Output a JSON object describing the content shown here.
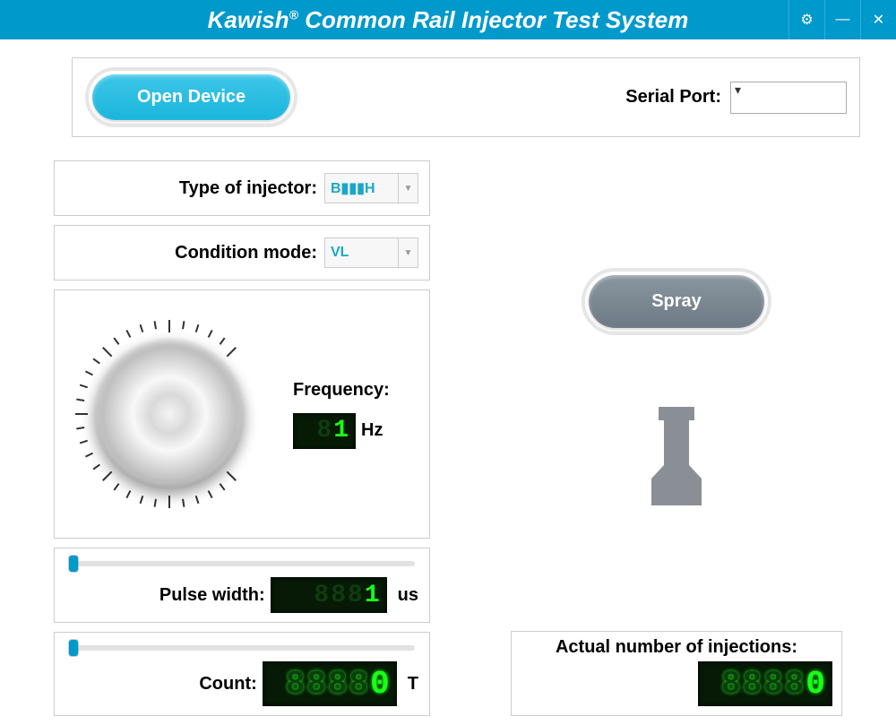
{
  "title_html": "Kawish® Common Rail Injector Test System",
  "window": {
    "settings": "⚙",
    "minimize": "—",
    "close": "✕"
  },
  "open_device_label": "Open Device",
  "serial_port": {
    "label": "Serial Port:",
    "value": ""
  },
  "injector_type": {
    "label": "Type of injector:",
    "value": "B▮▮▮H"
  },
  "condition_mode": {
    "label": "Condition mode:",
    "value": "VL"
  },
  "frequency": {
    "label": "Frequency:",
    "value": "1",
    "unit": "Hz"
  },
  "pulse_width": {
    "label": "Pulse width:",
    "value": "1",
    "dim_prefix": "888",
    "unit": "us"
  },
  "count": {
    "label": "Count:",
    "value": "0",
    "dim_prefix": "8888",
    "unit": "T"
  },
  "spray_label": "Spray",
  "actual_injections": {
    "label": "Actual number of injections:",
    "value": "0",
    "dim_prefix": "8888"
  }
}
